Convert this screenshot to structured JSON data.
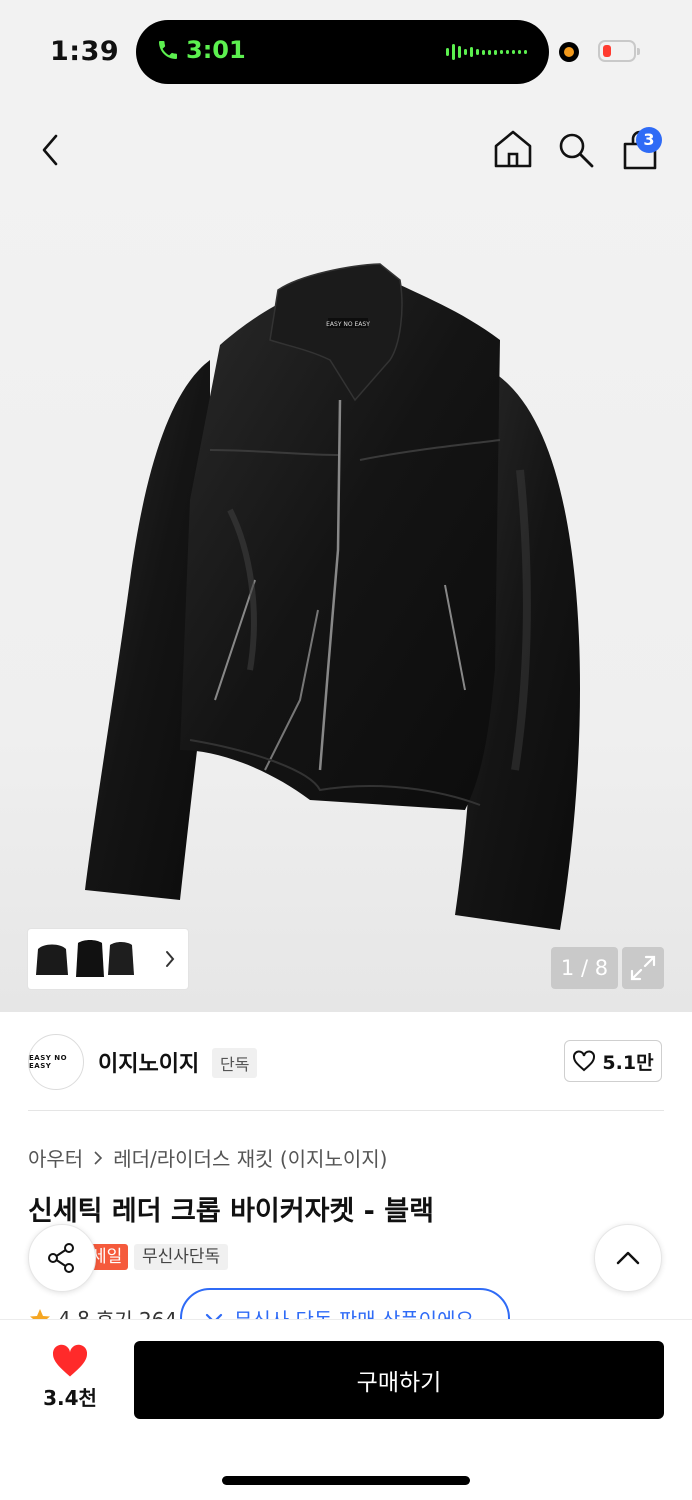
{
  "status_bar": {
    "time": "1:39",
    "call_time": "3:01"
  },
  "header": {
    "cart_count": "3"
  },
  "gallery": {
    "counter": "1 / 8",
    "jacket_logo": "EASY NO EASY"
  },
  "brand": {
    "logo_text": "EASY NO EASY",
    "name": "이지노이지",
    "tag": "단독",
    "likes": "5.1만"
  },
  "product": {
    "breadcrumb": [
      "아우터",
      "레더/라이더스 재킷 (이지노이지)"
    ],
    "title": "신세틱 레더 크롭 바이커자켓 - 블랙",
    "badges": {
      "sale": "세일",
      "exclusive": "무신사단독"
    },
    "rating": "4.8",
    "reviews": "후기 264",
    "notice": "무신사 단독 판매 상품이에요"
  },
  "bottom_bar": {
    "wish_count": "3.4천",
    "buy_label": "구매하기"
  },
  "colors": {
    "accent_blue": "#2f6bf6",
    "sale_red": "#f55a3c",
    "heart_red": "#ff2a2a",
    "call_green": "#5cf04f"
  }
}
